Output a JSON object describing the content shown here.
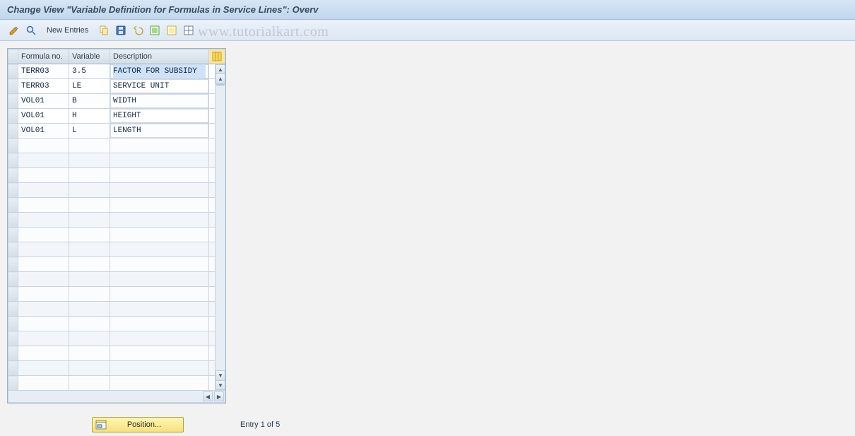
{
  "title": "Change View \"Variable Definition for Formulas in Service Lines\": Overv",
  "toolbar": {
    "new_entries": "New Entries"
  },
  "watermark": "www.tutorialkart.com",
  "table": {
    "headers": {
      "formula_no": "Formula no.",
      "variable": "Variable",
      "description": "Description"
    },
    "rows": [
      {
        "formula_no": "TERR03",
        "variable": "3.5",
        "description": "FACTOR FOR SUBSIDY"
      },
      {
        "formula_no": "TERR03",
        "variable": "LE",
        "description": "SERVICE UNIT"
      },
      {
        "formula_no": "VOL01",
        "variable": "B",
        "description": "WIDTH"
      },
      {
        "formula_no": "VOL01",
        "variable": "H",
        "description": "HEIGHT"
      },
      {
        "formula_no": "VOL01",
        "variable": "L",
        "description": "LENGTH"
      }
    ],
    "empty_rows": 17
  },
  "footer": {
    "position_label": "Position...",
    "entry_text": "Entry 1 of 5"
  }
}
